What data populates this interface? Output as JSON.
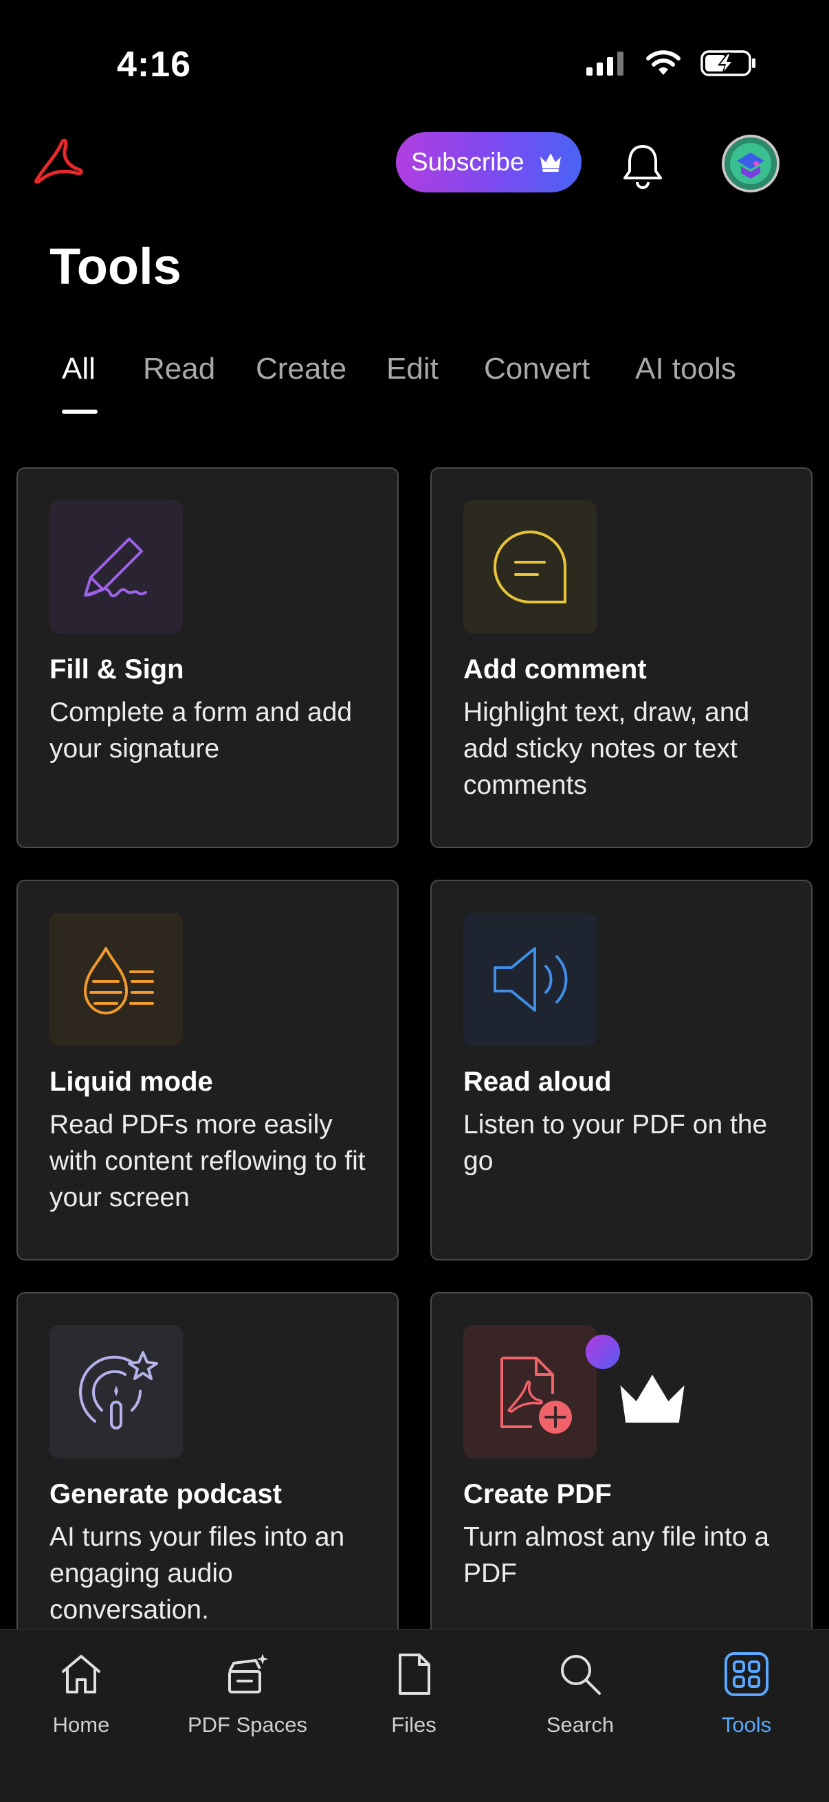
{
  "status_bar": {
    "time": "4:16"
  },
  "header": {
    "subscribe_label": "Subscribe"
  },
  "page": {
    "title": "Tools"
  },
  "tabs": [
    {
      "label": "All",
      "active": true
    },
    {
      "label": "Read"
    },
    {
      "label": "Create"
    },
    {
      "label": "Edit"
    },
    {
      "label": "Convert"
    },
    {
      "label": "AI tools"
    }
  ],
  "tools": [
    {
      "title": "Fill & Sign",
      "desc": "Complete a form and add your signature",
      "icon": "signature-pen-icon",
      "icon_color": "#9d63e8",
      "bg": "#2a2432"
    },
    {
      "title": "Add comment",
      "desc": "Highlight text, draw, and add sticky notes or text comments",
      "icon": "comment-bubble-icon",
      "icon_color": "#e8c53a",
      "bg": "#2c2a1f"
    },
    {
      "title": "Liquid mode",
      "desc": "Read PDFs more easily with content reflowing to fit your screen",
      "icon": "liquid-drop-icon",
      "icon_color": "#f29a2e",
      "bg": "#2e271e"
    },
    {
      "title": "Read aloud",
      "desc": "Listen to your PDF on the go",
      "icon": "speaker-icon",
      "icon_color": "#3f8ee8",
      "bg": "#1e2430"
    },
    {
      "title": "Generate podcast",
      "desc": "AI turns your files into an engaging audio conversation.",
      "icon": "podcast-sparkle-icon",
      "icon_color": "#b6b3ea",
      "bg": "#2a2a30"
    },
    {
      "title": "Create PDF",
      "desc": "Turn almost any file into a PDF",
      "icon": "create-pdf-icon",
      "icon_color": "#f0636a",
      "bg": "#3a2526",
      "premium": true
    }
  ],
  "bottom_nav": [
    {
      "label": "Home",
      "icon": "home-icon"
    },
    {
      "label": "PDF Spaces",
      "icon": "pdf-spaces-icon"
    },
    {
      "label": "Files",
      "icon": "file-icon"
    },
    {
      "label": "Search",
      "icon": "search-icon"
    },
    {
      "label": "Tools",
      "icon": "tools-grid-icon",
      "active": true
    }
  ],
  "colors": {
    "accent_blue": "#5aa8ff",
    "acrobat_red": "#e8282b"
  }
}
